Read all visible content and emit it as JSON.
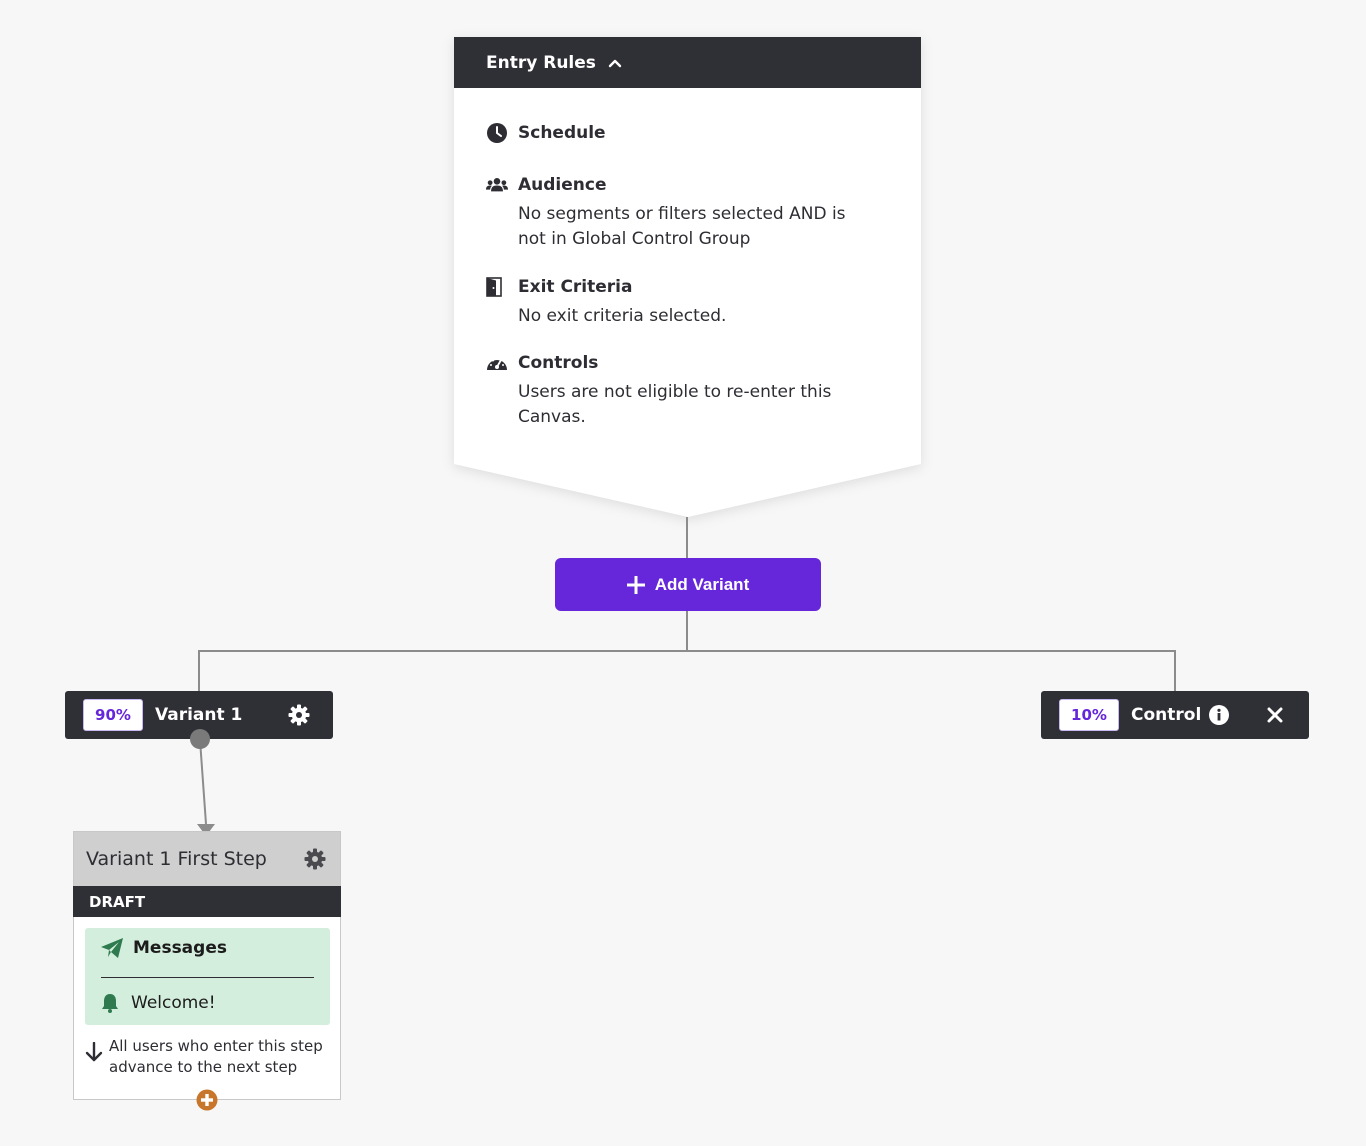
{
  "entry_rules": {
    "title": "Entry Rules",
    "toggle_icon": "chevron-up-icon",
    "items": [
      {
        "icon": "clock-icon",
        "title": "Schedule",
        "desc_lines": []
      },
      {
        "icon": "users-icon",
        "title": "Audience",
        "desc_lines": [
          "No segments or filters selected AND is",
          "not in Global Control Group"
        ]
      },
      {
        "icon": "door-exit-icon",
        "title": "Exit Criteria",
        "desc_lines": [
          "No exit criteria selected."
        ]
      },
      {
        "icon": "gauge-icon",
        "title": "Controls",
        "desc_lines": [
          "Users are not eligible to re-enter this",
          "Canvas."
        ]
      }
    ]
  },
  "add_variant": {
    "label": "Add Variant",
    "icon": "plus-icon"
  },
  "variants": [
    {
      "percent": "90%",
      "name": "Variant 1",
      "action_icon": "gear-icon"
    },
    {
      "percent": "10%",
      "name": "Control",
      "info_icon": "info-icon",
      "action_icon": "close-icon"
    }
  ],
  "step": {
    "title": "Variant 1 First Step",
    "settings_icon": "gear-icon",
    "status": "DRAFT",
    "messages_label": "Messages",
    "messages_icon": "paper-plane-icon",
    "message_name": "Welcome!",
    "message_icon": "bell-icon",
    "advance_text_1": "All users who enter this step",
    "advance_text_2": "advance to the next step",
    "advance_icon": "arrow-down-icon",
    "add_icon": "plus-circle-icon"
  },
  "colors": {
    "brand_purple": "#6527d9",
    "dark_header": "#2f2f36",
    "message_green": "#d4eedd",
    "icon_green": "#2f7a4f",
    "add_orange": "#c7762b"
  }
}
